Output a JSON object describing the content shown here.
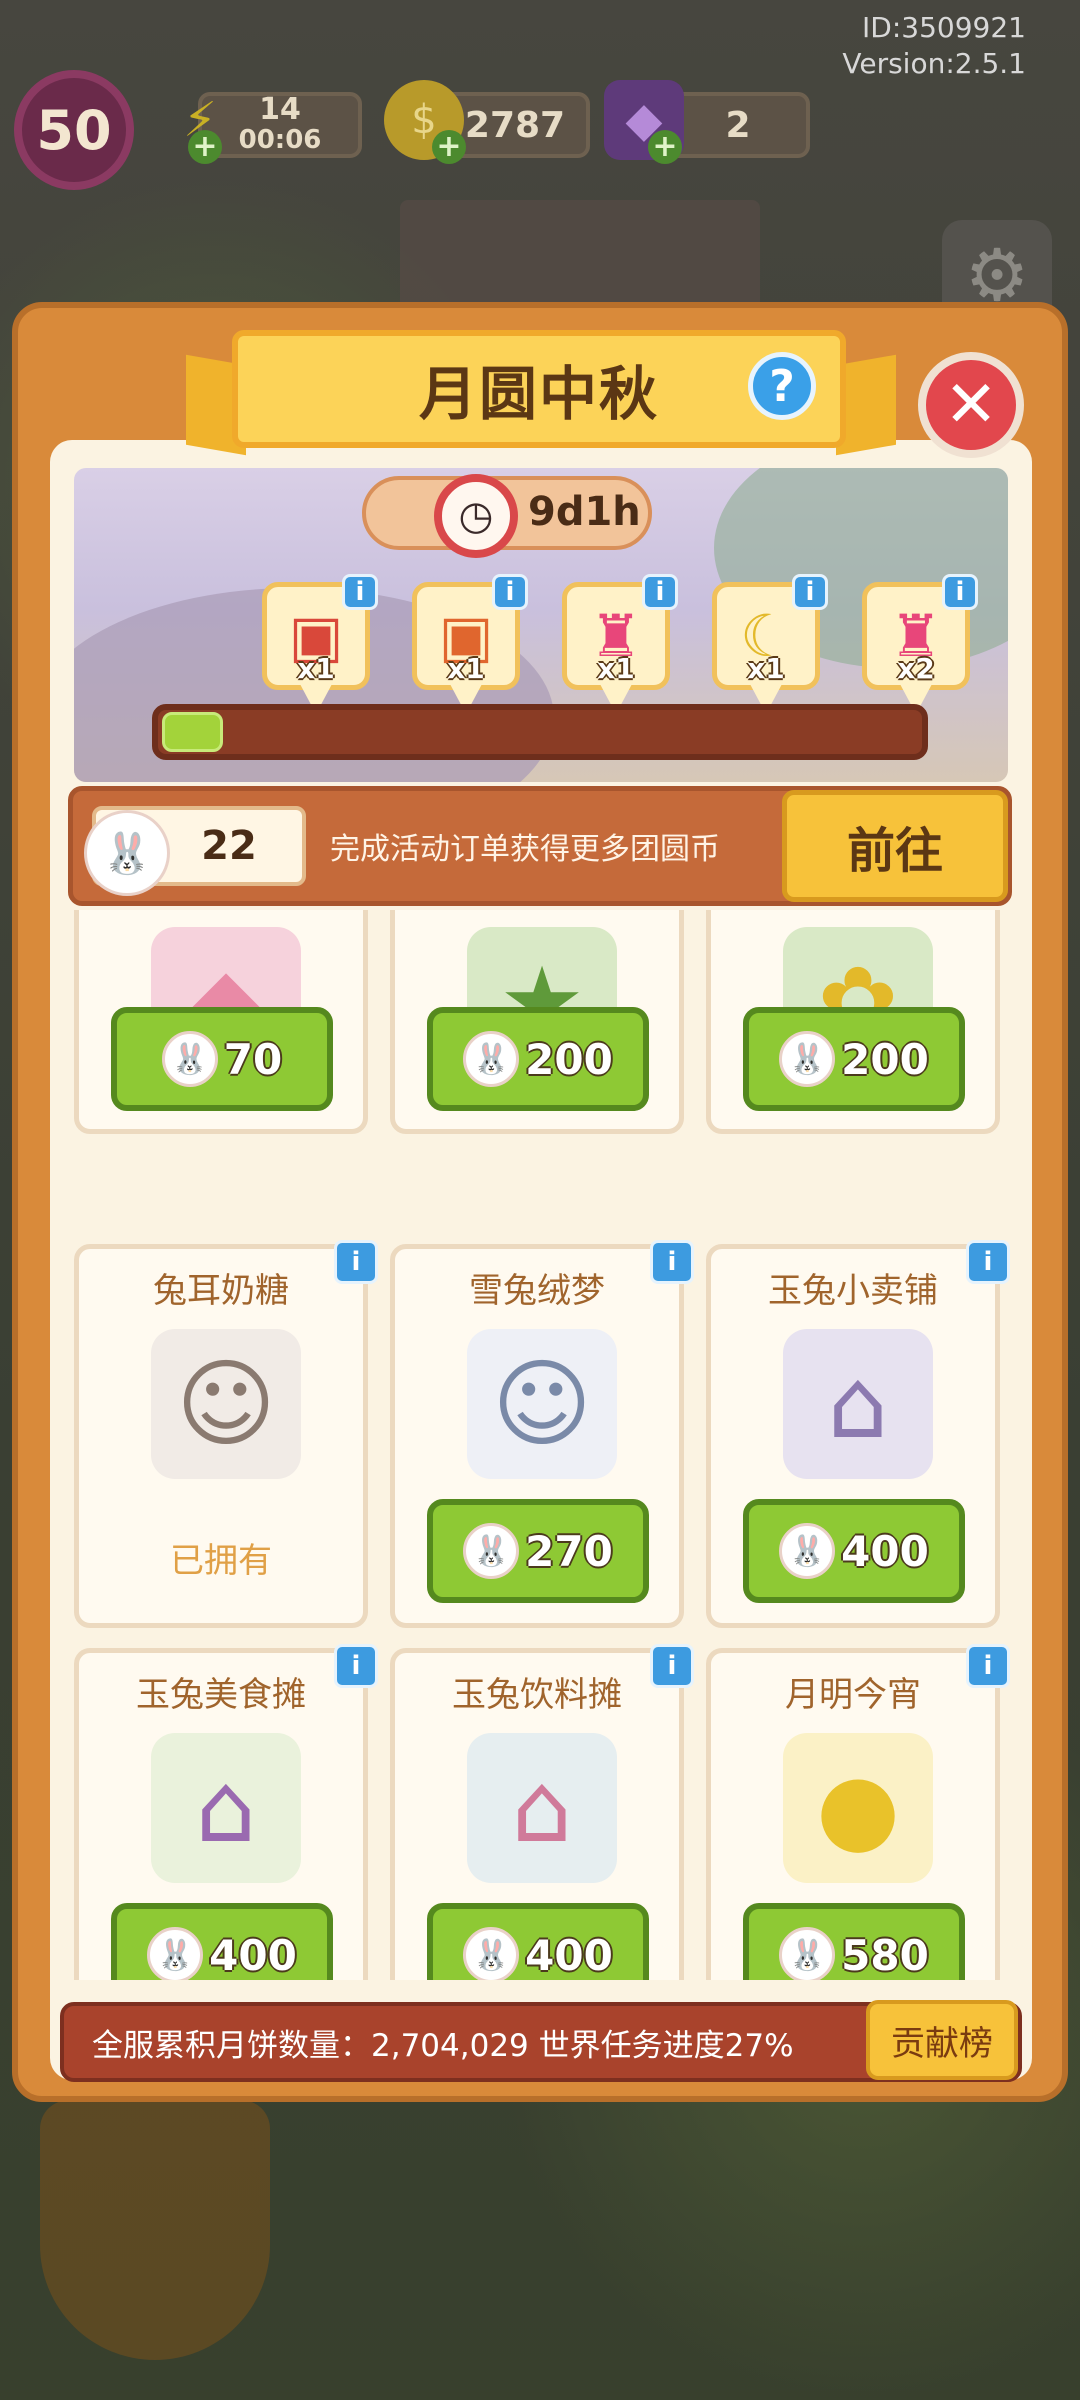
{
  "hud": {
    "level": "50",
    "energy": "14",
    "energy_timer": "00:06",
    "coins": "2787",
    "gems": "2",
    "id_text": "ID:3509921",
    "version_text": "Version:2.5.1"
  },
  "panel": {
    "title": "月圆中秋",
    "help_icon": "question-icon",
    "close_icon": "close-icon"
  },
  "banner": {
    "timer": "9d1h",
    "progress_fraction": 0.08,
    "rewards": [
      {
        "icon": "mooncake-box-red",
        "qty": "x1"
      },
      {
        "icon": "mooncake-box-orange",
        "qty": "x1"
      },
      {
        "icon": "pink-backpack",
        "qty": "x1"
      },
      {
        "icon": "moon-decoration",
        "qty": "x1"
      },
      {
        "icon": "pink-backpack",
        "qty": "x2"
      }
    ]
  },
  "coinbar": {
    "count": "22",
    "description": "完成活动订单获得更多团圆币",
    "goto_label": "前往"
  },
  "shop": {
    "row1": [
      {
        "icon": "bunny-cushion",
        "price": "70"
      },
      {
        "icon": "star-planter",
        "price": "200"
      },
      {
        "icon": "bunny-planter",
        "price": "200"
      }
    ],
    "row2": [
      {
        "name": "兔耳奶糖",
        "icon": "bunny-girl",
        "owned": "已拥有"
      },
      {
        "name": "雪兔绒梦",
        "icon": "bunny-boy",
        "price": "270"
      },
      {
        "name": "玉兔小卖铺",
        "icon": "bunny-shop",
        "price": "400"
      }
    ],
    "row3": [
      {
        "name": "玉兔美食摊",
        "icon": "food-stall",
        "price": "400"
      },
      {
        "name": "玉兔饮料摊",
        "icon": "drink-stall",
        "price": "400"
      },
      {
        "name": "月明今宵",
        "icon": "moon-lamp",
        "price": "580"
      }
    ]
  },
  "footer": {
    "text": "全服累积月饼数量：2,704,029  世界任务进度27%",
    "rank_label": "贡献榜"
  }
}
